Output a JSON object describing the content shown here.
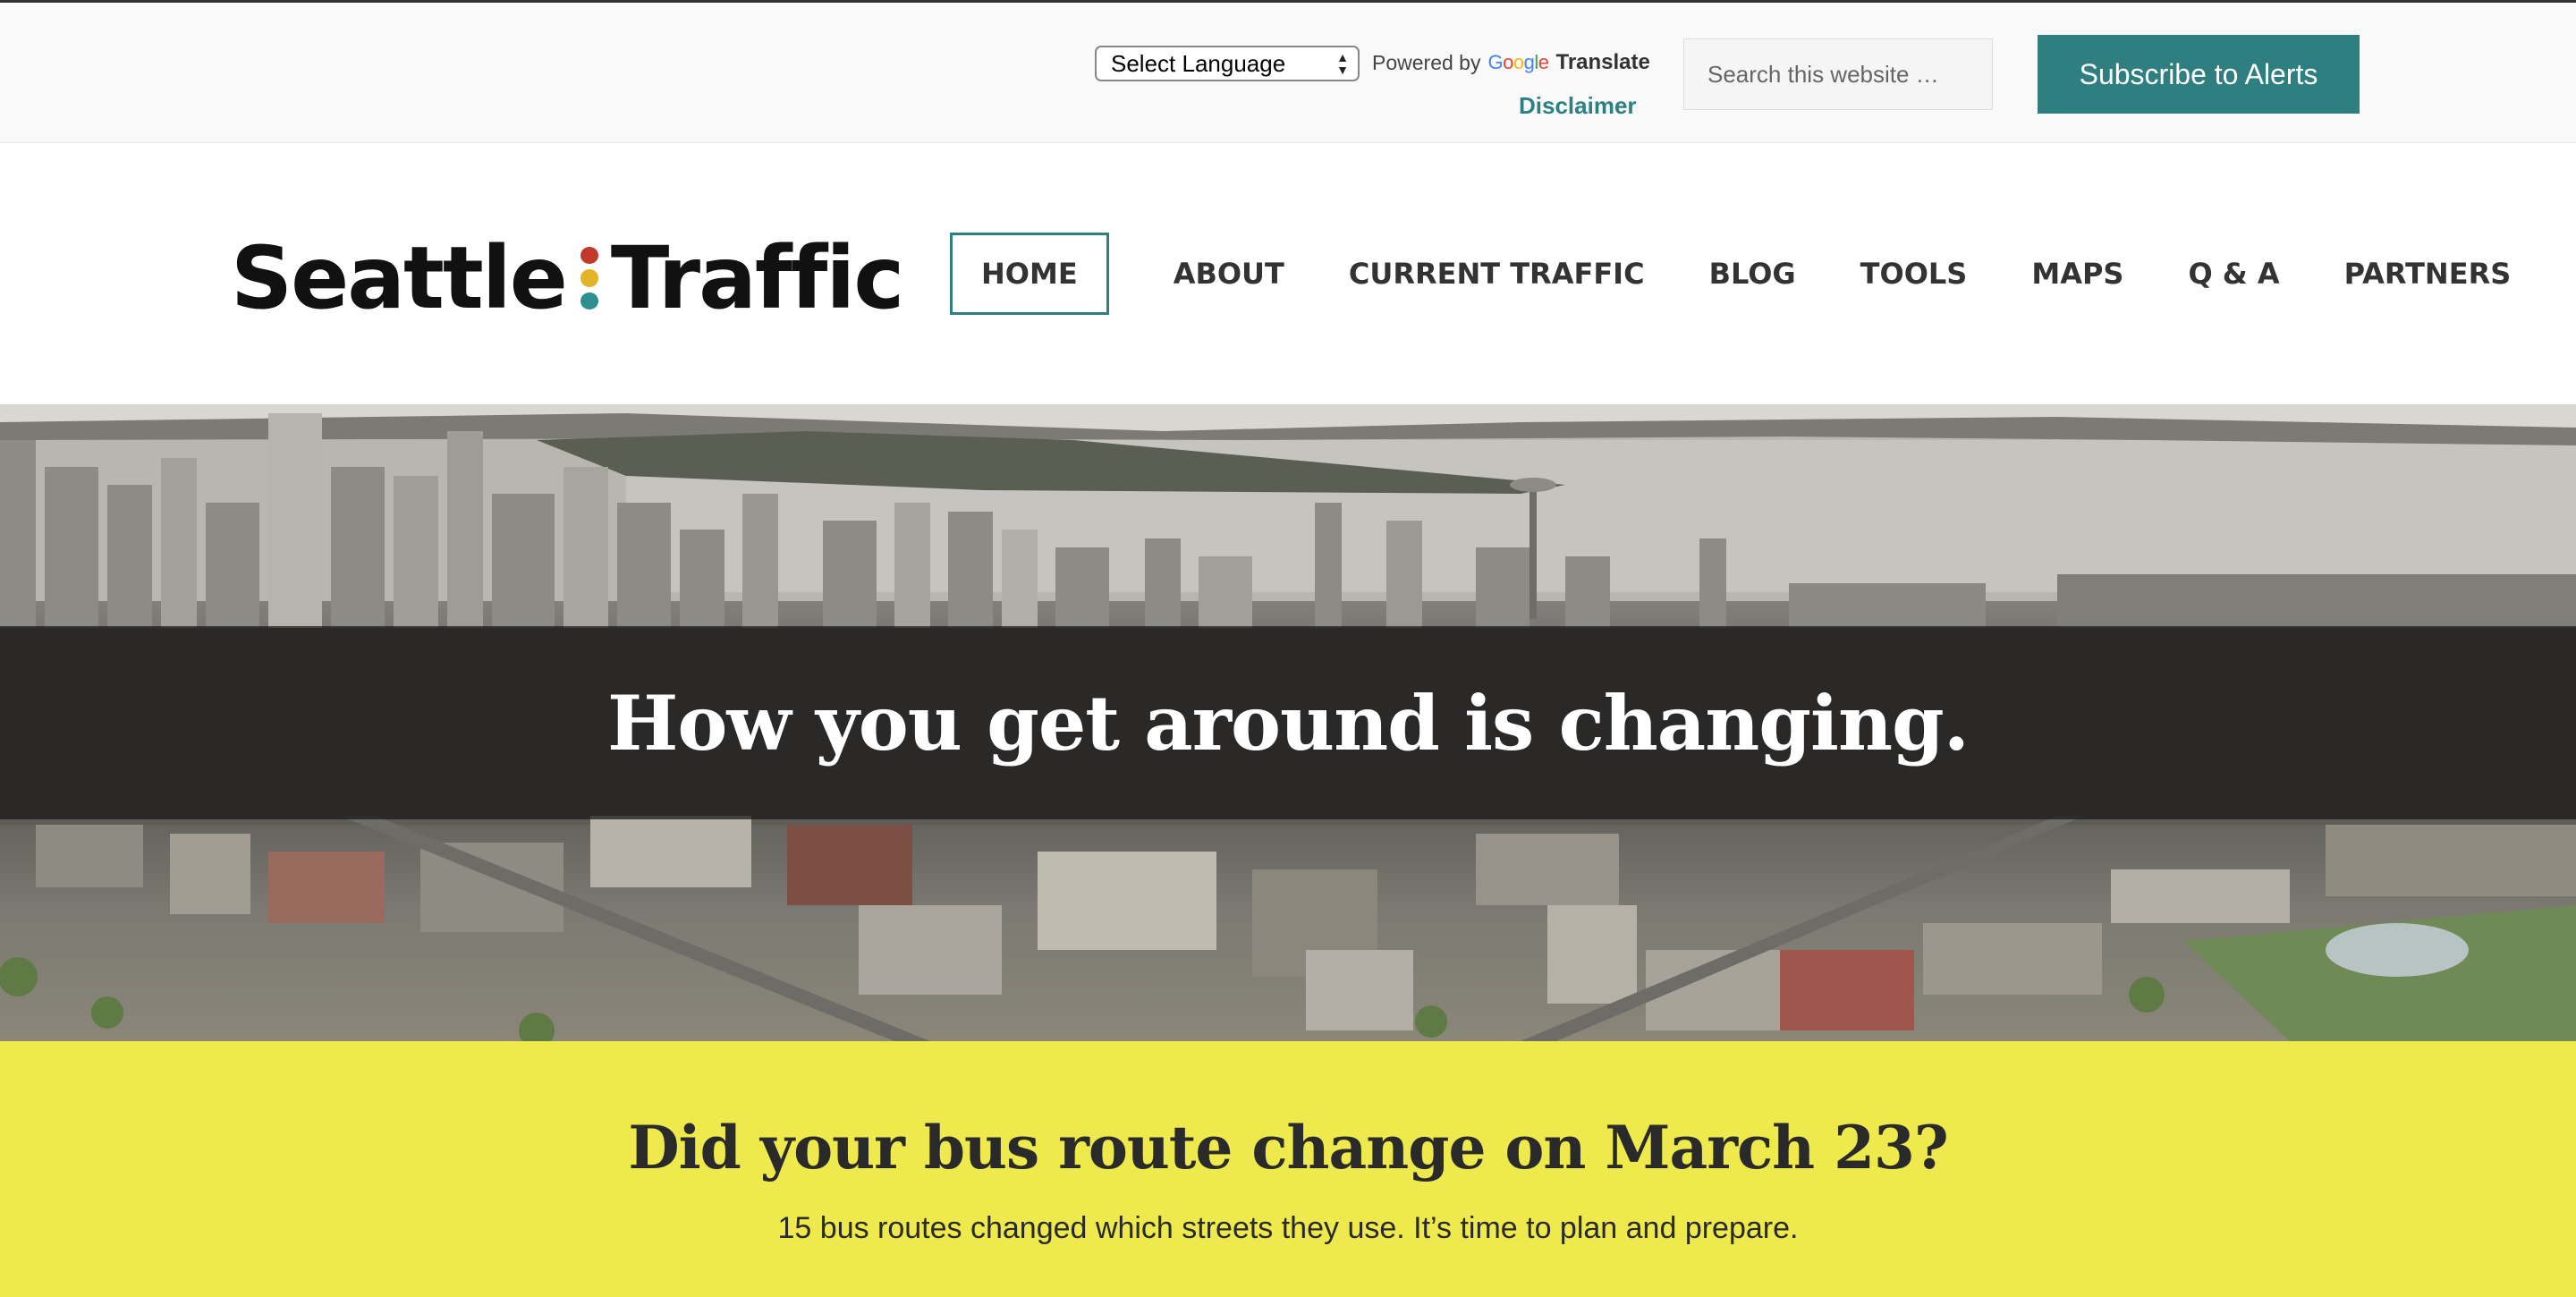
{
  "utility": {
    "language_select": "Select Language",
    "powered_by": "Powered by",
    "google_letters": [
      "G",
      "o",
      "o",
      "g",
      "l",
      "e"
    ],
    "translate": "Translate",
    "disclaimer": "Disclaimer",
    "search_placeholder": "Search this website …",
    "subscribe": "Subscribe to Alerts"
  },
  "logo": {
    "left": "Seattle",
    "right": "Traffic",
    "dot_colors": [
      "#c0392b",
      "#e3b32a",
      "#2f8f8f"
    ]
  },
  "nav": {
    "items": [
      "HOME",
      "ABOUT",
      "CURRENT TRAFFIC",
      "BLOG",
      "TOOLS",
      "MAPS",
      "Q & A",
      "PARTNERS"
    ],
    "active": "HOME"
  },
  "hero": {
    "title": "How you get around is changing."
  },
  "banner": {
    "title": "Did your bus route change on March 23?",
    "subtitle": "15 bus routes changed which streets they use. It’s time to plan and prepare."
  },
  "colors": {
    "accent": "#2f7f81",
    "banner": "#eeea4e"
  }
}
